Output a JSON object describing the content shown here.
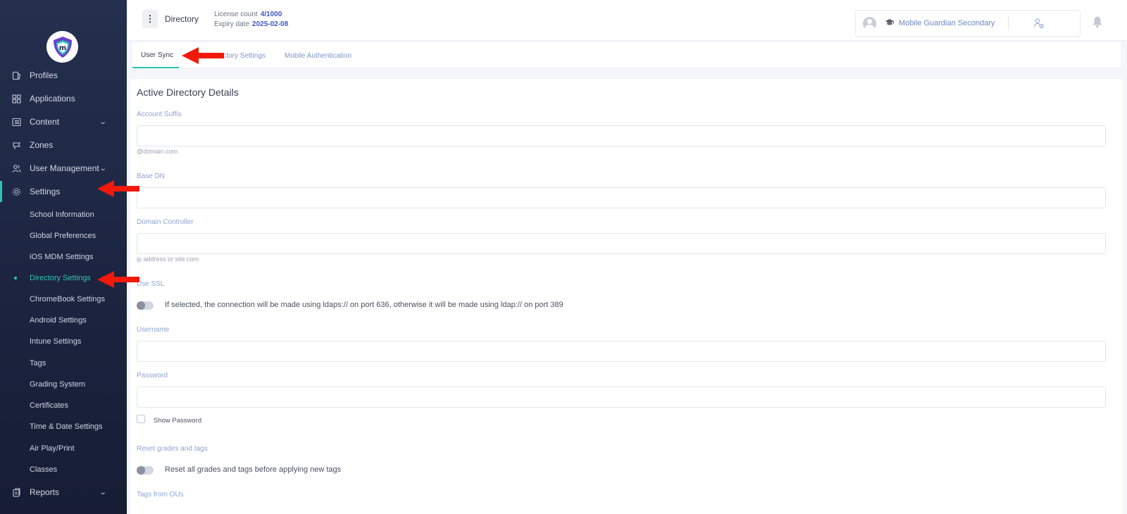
{
  "colors": {
    "accent": "#2bc6b3",
    "link": "#3d57c8",
    "arrow": "#f0190a",
    "sidebar_bg": "#1c2440"
  },
  "sidebar": {
    "logo_icon": "mobile-guardian-logo",
    "items": [
      {
        "label": "Profiles",
        "icon": "profiles-icon"
      },
      {
        "label": "Applications",
        "icon": "grid-icon"
      },
      {
        "label": "Content",
        "icon": "content-icon",
        "expandable": true
      },
      {
        "label": "Zones",
        "icon": "zones-icon"
      },
      {
        "label": "User Management",
        "icon": "users-icon",
        "expandable": true
      },
      {
        "label": "Settings",
        "icon": "gear-icon",
        "active": true
      }
    ],
    "sub_items": [
      "School Information",
      "Global Preferences",
      "iOS MDM Settings",
      "Directory Settings",
      "ChromeBook Settings",
      "Android Settings",
      "Intune Settings",
      "Tags",
      "Grading System",
      "Certificates",
      "Time & Date Settings",
      "Air Play/Print",
      "Classes"
    ],
    "current_sub": "Directory Settings",
    "bottom_item": {
      "label": "Reports",
      "icon": "reports-icon",
      "expandable": true
    }
  },
  "header": {
    "menu_icon": "kebab-menu-icon",
    "title": "Directory",
    "license_label": "License count",
    "license_value": "4/1000",
    "expiry_label": "Expiry date",
    "expiry_value": "2025-02-08",
    "school_name": "Mobile Guardian Secondary",
    "icons": [
      "avatar-icon",
      "graduation-cap-icon",
      "switch-user-icon",
      "bell-icon"
    ]
  },
  "tabs": [
    {
      "label": "User Sync",
      "active": true
    },
    {
      "label": "Directory Settings",
      "active": false
    },
    {
      "label": "Mobile Authentication",
      "active": false
    }
  ],
  "form": {
    "section_title": "Active Directory Details",
    "account_suffix": {
      "label": "Account Suffix",
      "value": "",
      "hint": "@domain.com"
    },
    "base_dn": {
      "label": "Base DN",
      "value": ""
    },
    "domain_controller": {
      "label": "Domain Controller",
      "value": "",
      "hint": "ip address or site.com"
    },
    "use_ssl": {
      "label": "Use SSL",
      "enabled": false,
      "text": "If selected, the connection will be made using ldaps:// on port 636, otherwise it will be made using ldap:// on port 389"
    },
    "username": {
      "label": "Username",
      "value": ""
    },
    "password": {
      "label": "Password",
      "value": ""
    },
    "show_password": {
      "label": "Show Password",
      "checked": false
    },
    "reset": {
      "label": "Reset grades and tags",
      "enabled": false,
      "text": "Reset all grades and tags before applying new tags"
    },
    "tags_from_ous": {
      "label": "Tags from OUs"
    }
  }
}
